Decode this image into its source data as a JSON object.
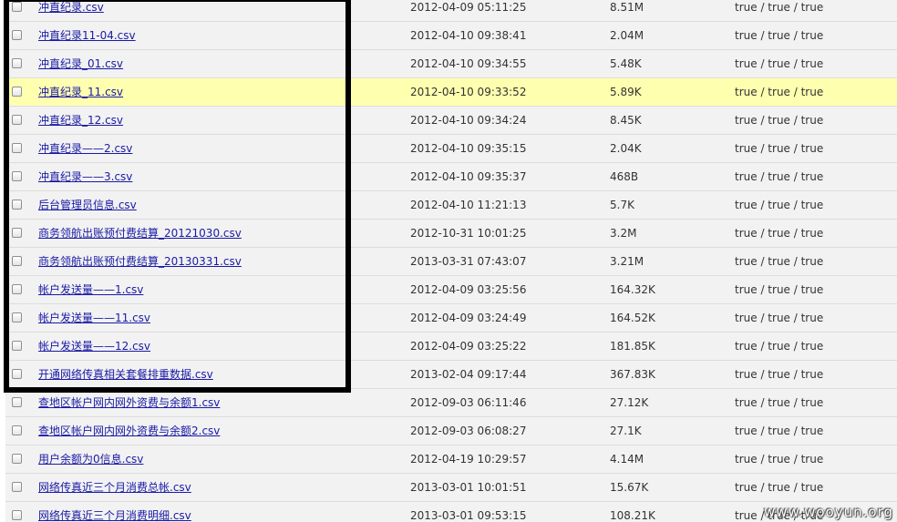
{
  "files": [
    {
      "name": "冲直纪录.csv",
      "date": "2012-04-09 05:11:25",
      "size": "8.51M",
      "perm": "true / true / true"
    },
    {
      "name": "冲直纪录11-04.csv",
      "date": "2012-04-10 09:38:41",
      "size": "2.04M",
      "perm": "true / true / true"
    },
    {
      "name": "冲直纪录_01.csv",
      "date": "2012-04-10 09:34:55",
      "size": "5.48K",
      "perm": "true / true / true"
    },
    {
      "name": "冲直纪录_11.csv",
      "date": "2012-04-10 09:33:52",
      "size": "5.89K",
      "perm": "true / true / true",
      "highlighted": true
    },
    {
      "name": "冲直纪录_12.csv",
      "date": "2012-04-10 09:34:24",
      "size": "8.45K",
      "perm": "true / true / true"
    },
    {
      "name": "冲直纪录——2.csv",
      "date": "2012-04-10 09:35:15",
      "size": "2.04K",
      "perm": "true / true / true"
    },
    {
      "name": "冲直纪录——3.csv",
      "date": "2012-04-10 09:35:37",
      "size": "468B",
      "perm": "true / true / true"
    },
    {
      "name": "后台管理员信息.csv",
      "date": "2012-04-10 11:21:13",
      "size": "5.7K",
      "perm": "true / true / true"
    },
    {
      "name": "商务领航出账预付费结算_20121030.csv",
      "date": "2012-10-31 10:01:25",
      "size": "3.2M",
      "perm": "true / true / true"
    },
    {
      "name": "商务领航出账预付费结算_20130331.csv",
      "date": "2013-03-31 07:43:07",
      "size": "3.21M",
      "perm": "true / true / true"
    },
    {
      "name": "帐户发送量——1.csv",
      "date": "2012-04-09 03:25:56",
      "size": "164.32K",
      "perm": "true / true / true"
    },
    {
      "name": "帐户发送量——11.csv",
      "date": "2012-04-09 03:24:49",
      "size": "164.52K",
      "perm": "true / true / true"
    },
    {
      "name": "帐户发送量——12.csv",
      "date": "2012-04-09 03:25:22",
      "size": "181.85K",
      "perm": "true / true / true"
    },
    {
      "name": "开通网络传真相关套餐排重数据.csv",
      "date": "2013-02-04 09:17:44",
      "size": "367.83K",
      "perm": "true / true / true"
    },
    {
      "name": "查地区帐户网内网外资费与余额1.csv",
      "date": "2012-09-03 06:11:46",
      "size": "27.12K",
      "perm": "true / true / true"
    },
    {
      "name": "查地区帐户网内网外资费与余额2.csv",
      "date": "2012-09-03 06:08:27",
      "size": "27.1K",
      "perm": "true / true / true"
    },
    {
      "name": "用户余额为0信息.csv",
      "date": "2012-04-19 10:29:57",
      "size": "4.14M",
      "perm": "true / true / true"
    },
    {
      "name": "网络传真近三个月消费总帐.csv",
      "date": "2013-03-01 10:01:51",
      "size": "15.67K",
      "perm": "true / true / true"
    },
    {
      "name": "网络传真近三个月消费明细.csv",
      "date": "2013-03-01 09:53:15",
      "size": "108.21K",
      "perm": "true / true / true"
    }
  ],
  "colors": {
    "row_bg": "#f2f2f2",
    "highlight_bg": "#ffffb0",
    "link": "#1a1aa6",
    "annotation_box": "#000000"
  },
  "watermark": "www.wooyun.org"
}
